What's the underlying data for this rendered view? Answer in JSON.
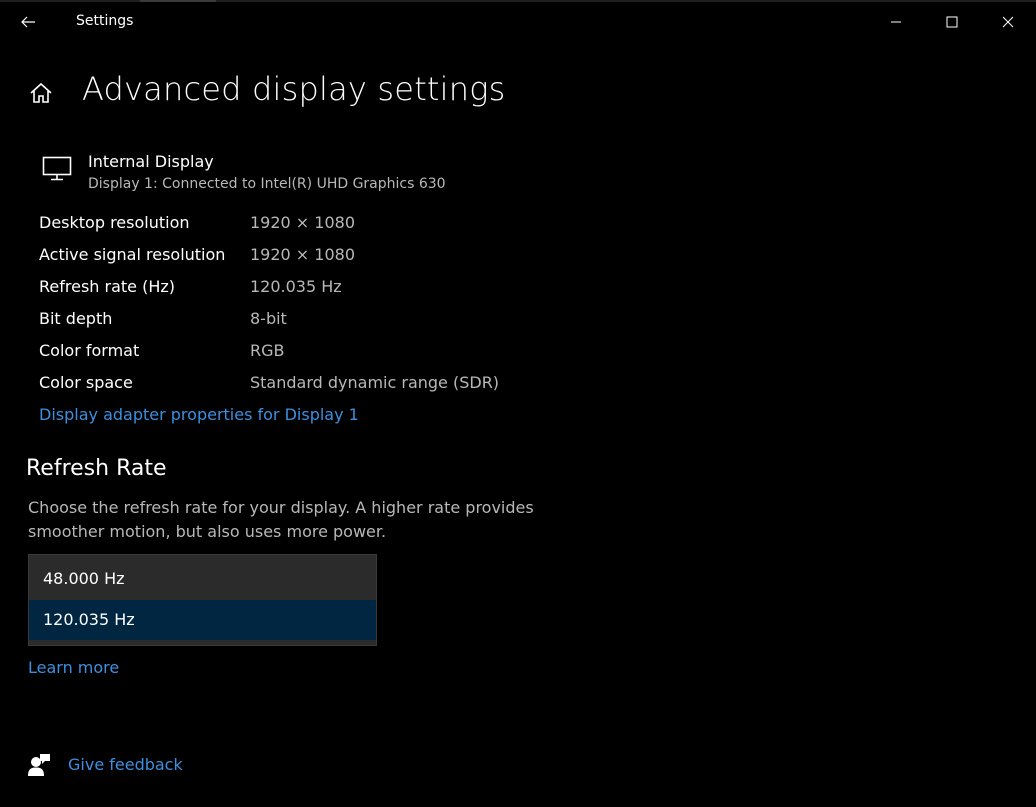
{
  "window": {
    "app_title": "Settings"
  },
  "header": {
    "page_title": "Advanced display settings"
  },
  "display": {
    "name": "Internal Display",
    "subtitle": "Display 1: Connected to Intel(R) UHD Graphics 630"
  },
  "specs": [
    {
      "label": "Desktop resolution",
      "value": "1920 × 1080"
    },
    {
      "label": "Active signal resolution",
      "value": "1920 × 1080"
    },
    {
      "label": "Refresh rate (Hz)",
      "value": "120.035 Hz"
    },
    {
      "label": "Bit depth",
      "value": "8-bit"
    },
    {
      "label": "Color format",
      "value": "RGB"
    },
    {
      "label": "Color space",
      "value": "Standard dynamic range (SDR)"
    }
  ],
  "adapter_link": "Display adapter properties for Display 1",
  "refresh_rate": {
    "title": "Refresh Rate",
    "description": "Choose the refresh rate for your display. A higher rate provides smoother motion, but also uses more power.",
    "options": [
      "48.000 Hz",
      "120.035 Hz"
    ],
    "selected": "120.035 Hz"
  },
  "learn_more": "Learn more",
  "feedback": "Give feedback",
  "colors": {
    "background": "#000000",
    "link": "#3d8fe0",
    "selected_option": "#002642",
    "secondary_text": "#b8b8b8"
  }
}
